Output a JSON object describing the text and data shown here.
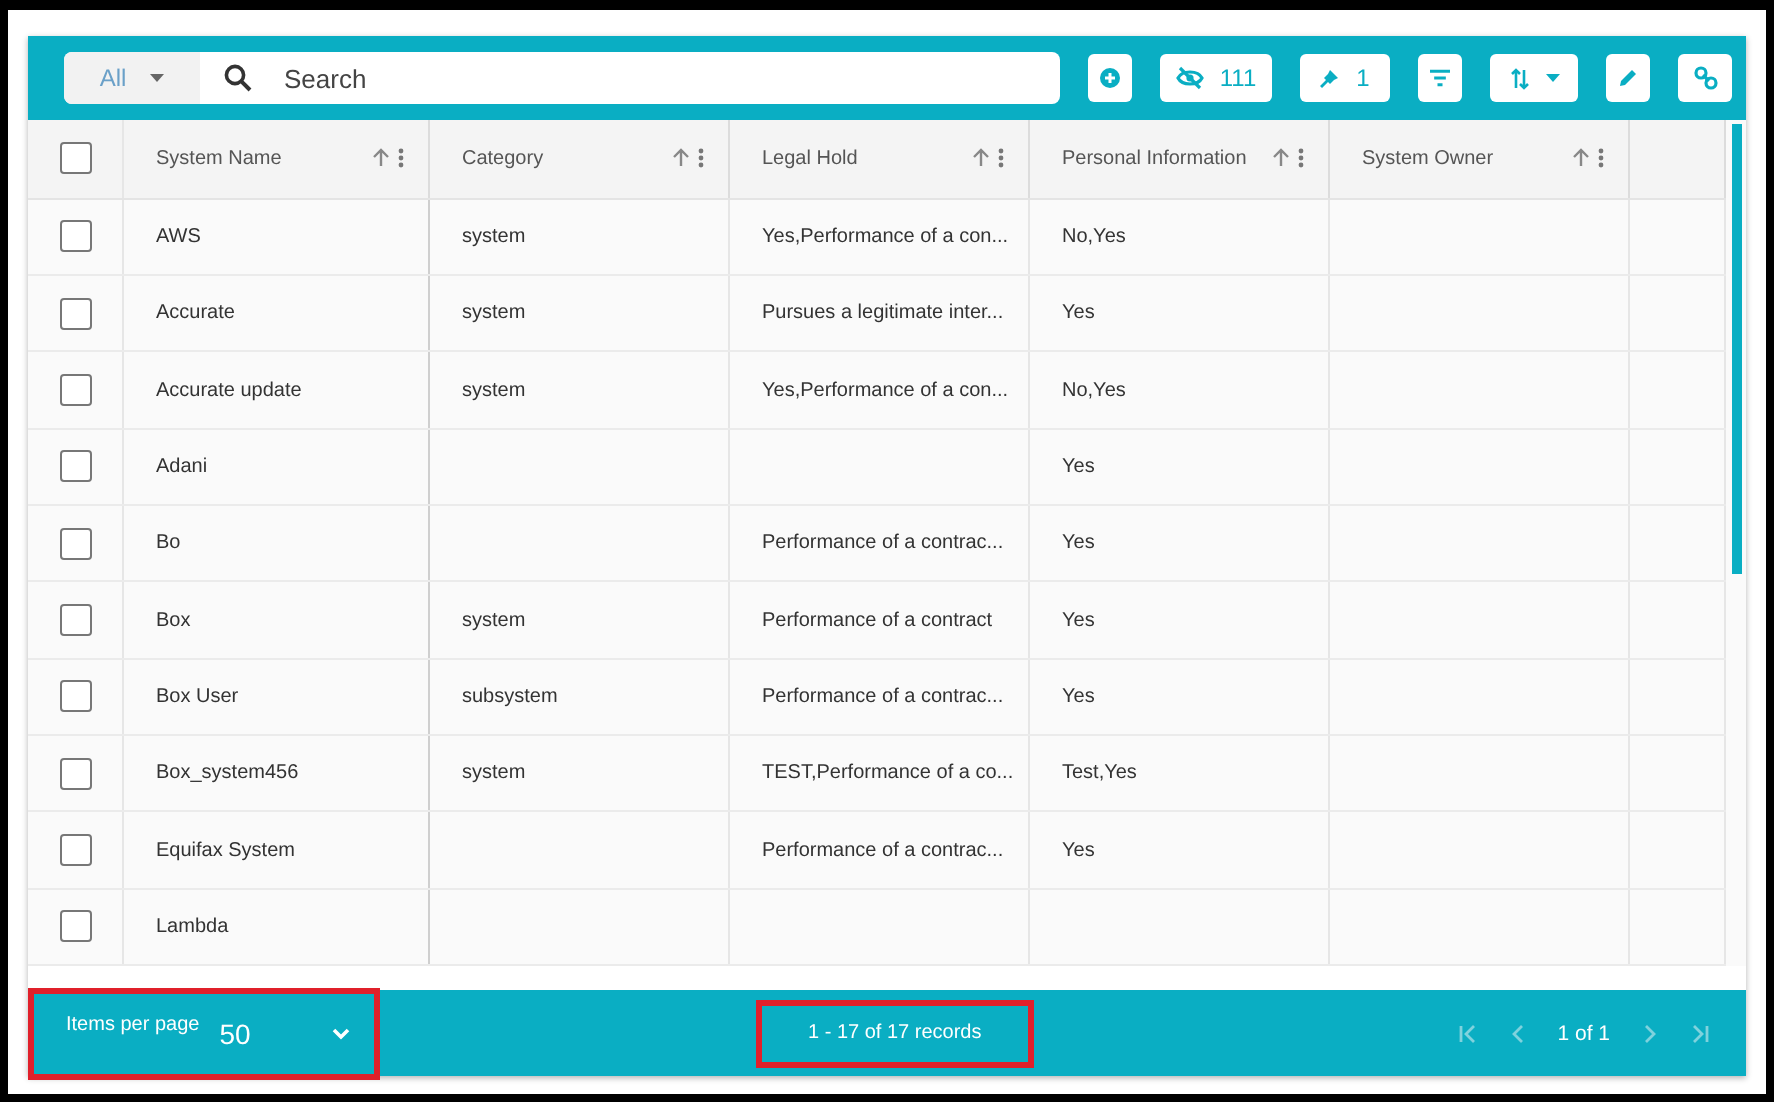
{
  "toolbar": {
    "scope": "All",
    "search": {
      "placeholder": "Search"
    },
    "hidden_count": "111",
    "pinned_count": "1"
  },
  "table": {
    "select_all_checked": false,
    "columns": [
      {
        "label": "System Name"
      },
      {
        "label": "Category"
      },
      {
        "label": "Legal Hold"
      },
      {
        "label": "Personal Information"
      },
      {
        "label": "System Owner"
      }
    ],
    "rows": [
      {
        "checked": false,
        "cells": [
          "AWS",
          "system",
          "Yes,Performance of a con...",
          "No,Yes",
          ""
        ]
      },
      {
        "checked": false,
        "cells": [
          "Accurate",
          "system",
          "Pursues a legitimate inter...",
          "Yes",
          ""
        ]
      },
      {
        "checked": false,
        "cells": [
          "Accurate update",
          "system",
          "Yes,Performance of a con...",
          "No,Yes",
          ""
        ]
      },
      {
        "checked": false,
        "cells": [
          "Adani",
          "",
          "",
          "Yes",
          ""
        ]
      },
      {
        "checked": false,
        "cells": [
          "Bo",
          "",
          "Performance of a contrac...",
          "Yes",
          ""
        ]
      },
      {
        "checked": false,
        "cells": [
          "Box",
          "system",
          "Performance of a contract",
          "Yes",
          ""
        ]
      },
      {
        "checked": false,
        "cells": [
          "Box User",
          "subsystem",
          "Performance of a contrac...",
          "Yes",
          ""
        ]
      },
      {
        "checked": false,
        "cells": [
          "Box_system456",
          "system",
          "TEST,Performance of a co...",
          "Test,Yes",
          ""
        ]
      },
      {
        "checked": false,
        "cells": [
          "Equifax System",
          "",
          "Performance of a contrac...",
          "Yes",
          ""
        ]
      },
      {
        "checked": false,
        "cells": [
          "Lambda",
          "",
          "",
          "",
          ""
        ]
      }
    ]
  },
  "footer": {
    "items_per_page_label": "Items per page",
    "items_per_page": "50",
    "records": "1 - 17 of 17 records",
    "page": "1 of 1",
    "highlighted": true
  }
}
